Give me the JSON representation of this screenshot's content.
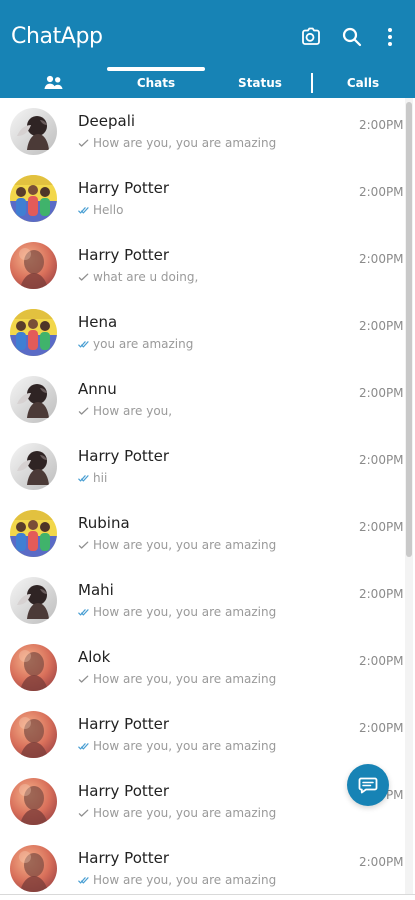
{
  "app": {
    "title": "ChatApp",
    "colors": {
      "primary": "#1783b5",
      "header_text": "#ffffff",
      "tick_grey": "#8f8f8f",
      "tick_blue": "#4a9fd3"
    },
    "icons": {
      "camera": "camera-icon",
      "search": "search-icon",
      "menu": "more-vert-icon",
      "community": "community-icon",
      "fab": "chat-message-icon"
    },
    "tabs": [
      {
        "label": "Chats",
        "active": true
      },
      {
        "label": "Status",
        "active": false
      },
      {
        "label": "Calls",
        "active": false
      }
    ]
  },
  "chats": [
    {
      "name": "Deepali",
      "time": "2:00PM",
      "preview": "How are you, you are amazing",
      "avatar_style": "portrait",
      "tick_color": "#8f8f8f"
    },
    {
      "name": "Harry Potter",
      "time": "2:00PM",
      "preview": "Hello",
      "avatar_style": "group",
      "tick_color": "#4a9fd3"
    },
    {
      "name": "Harry Potter",
      "time": "2:00PM",
      "preview": "what are u doing,",
      "avatar_style": "warm",
      "tick_color": "#8f8f8f"
    },
    {
      "name": "Hena",
      "time": "2:00PM",
      "preview": "you are amazing",
      "avatar_style": "group",
      "tick_color": "#4a9fd3"
    },
    {
      "name": "Annu",
      "time": "2:00PM",
      "preview": "How are you,",
      "avatar_style": "portrait",
      "tick_color": "#8f8f8f"
    },
    {
      "name": "Harry Potter",
      "time": "2:00PM",
      "preview": "hii",
      "avatar_style": "portrait",
      "tick_color": "#4a9fd3"
    },
    {
      "name": "Rubina",
      "time": "2:00PM",
      "preview": "How are you, you are amazing",
      "avatar_style": "group",
      "tick_color": "#8f8f8f"
    },
    {
      "name": "Mahi",
      "time": "2:00PM",
      "preview": "How are you, you are amazing",
      "avatar_style": "portrait",
      "tick_color": "#4a9fd3"
    },
    {
      "name": "Alok",
      "time": "2:00PM",
      "preview": "How are you, you are amazing",
      "avatar_style": "warm",
      "tick_color": "#8f8f8f"
    },
    {
      "name": "Harry Potter",
      "time": "2:00PM",
      "preview": "How are you, you are amazing",
      "avatar_style": "warm",
      "tick_color": "#4a9fd3"
    },
    {
      "name": "Harry Potter",
      "time": "2:00PM",
      "preview": "How are you, you are amazing",
      "avatar_style": "warm",
      "tick_color": "#8f8f8f"
    },
    {
      "name": "Harry Potter",
      "time": "2:00PM",
      "preview": "How are you, you are amazing",
      "avatar_style": "warm",
      "tick_color": "#4a9fd3"
    }
  ]
}
